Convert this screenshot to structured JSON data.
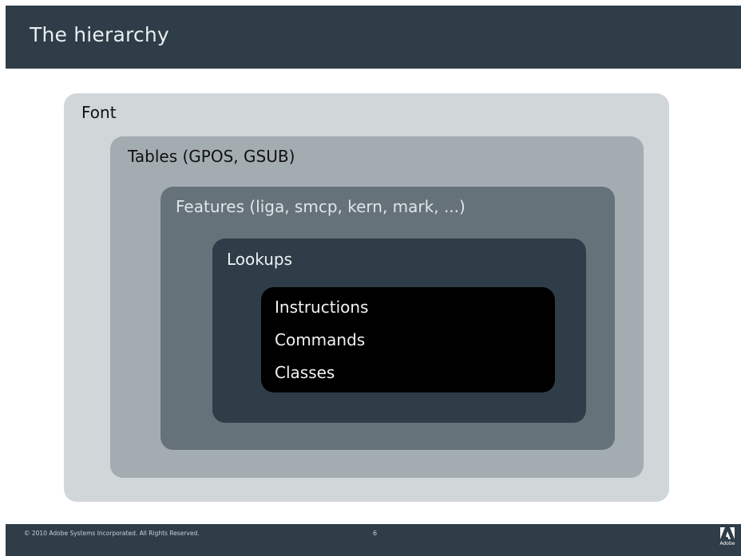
{
  "header": {
    "title": "The hierarchy"
  },
  "diagram": {
    "font_label": "Font",
    "tables_label": "Tables (GPOS, GSUB)",
    "features_label": "Features (liga, smcp, kern, mark, ...)",
    "lookups_label": "Lookups",
    "instruction_items": [
      "Instructions",
      "Commands",
      "Classes"
    ]
  },
  "footer": {
    "copyright": "© 2010 Adobe Systems Incorporated. All Rights Reserved.",
    "page_number": "6",
    "logo_text": "Adobe",
    "logo_icon": "adobe-logo-icon"
  },
  "colors": {
    "header_bg": "#2e3d47",
    "font_box": "#d1d6d9",
    "tables_box": "#a3acb1",
    "features_box": "#66727a",
    "lookups_box": "#2e3d47",
    "instructions_box": "#000000"
  }
}
